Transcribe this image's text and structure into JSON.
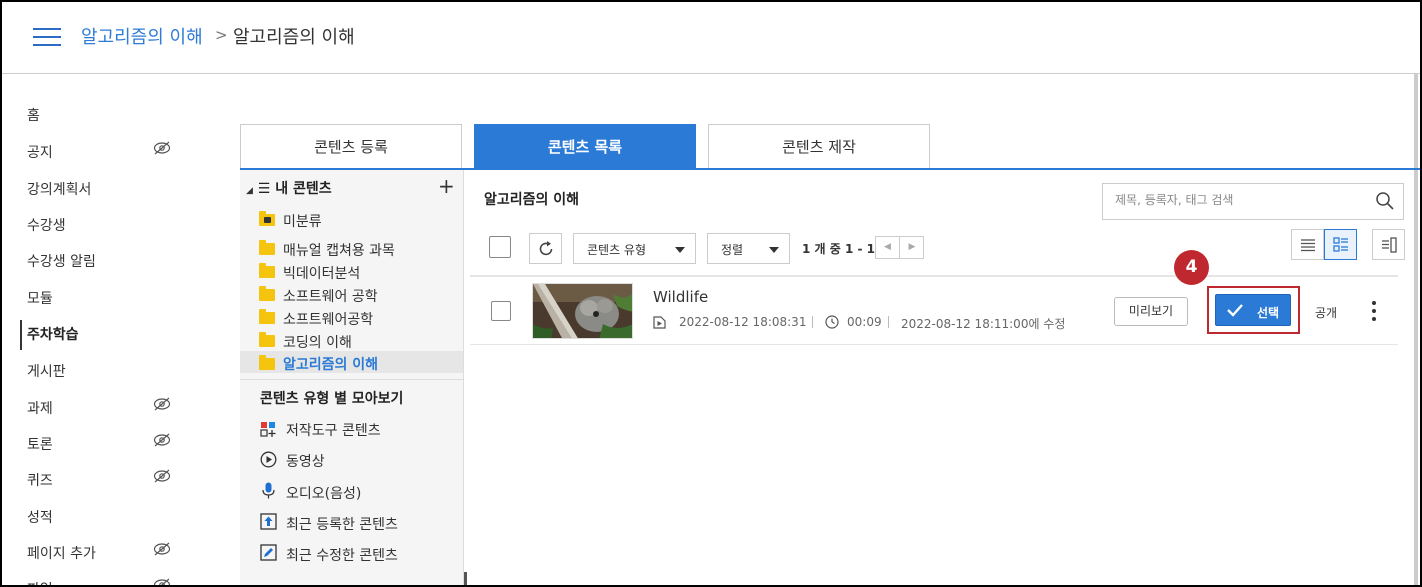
{
  "breadcrumb": {
    "course": "알고리즘의 이해",
    "separator": ">",
    "current": "알고리즘의 이해"
  },
  "nav": {
    "items": [
      {
        "label": "홈",
        "hidden": false
      },
      {
        "label": "공지",
        "hidden": true
      },
      {
        "label": "강의계획서",
        "hidden": false
      },
      {
        "label": "수강생",
        "hidden": false
      },
      {
        "label": "수강생 알림",
        "hidden": false
      },
      {
        "label": "모듈",
        "hidden": false
      },
      {
        "label": "주차학습",
        "hidden": false,
        "active": true
      },
      {
        "label": "게시판",
        "hidden": false
      },
      {
        "label": "과제",
        "hidden": true
      },
      {
        "label": "토론",
        "hidden": true
      },
      {
        "label": "퀴즈",
        "hidden": true
      },
      {
        "label": "성적",
        "hidden": false
      },
      {
        "label": "페이지 추가",
        "hidden": true
      },
      {
        "label": "파일",
        "hidden": true
      }
    ]
  },
  "tabs": [
    {
      "label": "콘텐츠 등록",
      "active": false
    },
    {
      "label": "콘텐츠 목록",
      "active": true
    },
    {
      "label": "콘텐츠 제작",
      "active": false
    }
  ],
  "tree": {
    "header": "내 콘텐츠",
    "add_label": "+",
    "folders": [
      {
        "label": "미분류",
        "locked": true
      },
      {
        "label": "매뉴얼 캡쳐용 과목"
      },
      {
        "label": "빅데이터분석"
      },
      {
        "label": "소프트웨어 공학"
      },
      {
        "label": "소프트웨어공학"
      },
      {
        "label": "코딩의 이해"
      },
      {
        "label": "알고리즘의 이해",
        "selected": true
      }
    ],
    "group_title": "콘텐츠 유형 별 모아보기",
    "types": [
      {
        "label": "저작도구 콘텐츠",
        "icon": "authoring-tool-icon"
      },
      {
        "label": "동영상",
        "icon": "video-play-icon"
      },
      {
        "label": "오디오(음성)",
        "icon": "microphone-icon"
      },
      {
        "label": "최근 등록한 콘텐츠",
        "icon": "upload-icon"
      },
      {
        "label": "최근 수정한 콘텐츠",
        "icon": "edit-icon"
      }
    ]
  },
  "main": {
    "title": "알고리즘의 이해",
    "search_placeholder": "제목, 등록자, 태그 검색",
    "type_select": "콘텐츠 유형",
    "sort_select": "정렬",
    "pager_text": "1 개 중 1 - 1",
    "items": [
      {
        "title": "Wildlife",
        "created": "2022-08-12 18:08:31",
        "duration": "00:09",
        "modified": "2022-08-12 18:11:00에 수정",
        "preview_label": "미리보기",
        "select_label": "선택",
        "visibility": "공개"
      }
    ]
  },
  "annotation": {
    "step": "4",
    "color": "#c0282f"
  },
  "colors": {
    "accent": "#2a7ad6",
    "highlight": "#c0282f",
    "folder": "#f4c40f"
  }
}
